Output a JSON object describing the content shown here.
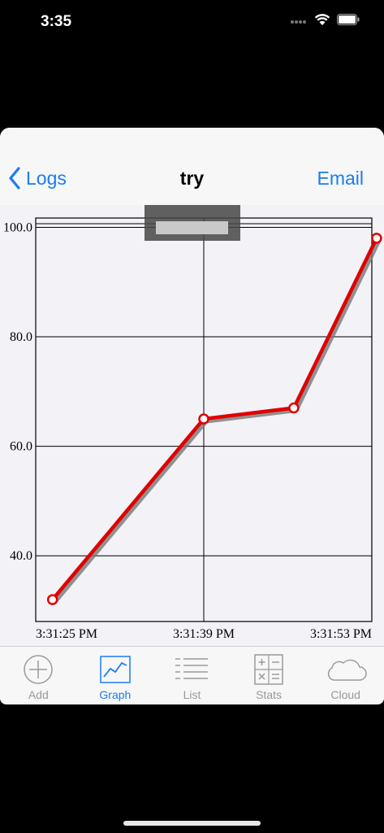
{
  "status": {
    "time": "3:35"
  },
  "navbar": {
    "back_label": "Logs",
    "title": "try",
    "email_label": "Email"
  },
  "tabbar": {
    "tabs": [
      {
        "label": "Add",
        "icon": "plus-circle-icon",
        "active": false
      },
      {
        "label": "Graph",
        "icon": "line-chart-icon",
        "active": true
      },
      {
        "label": "List",
        "icon": "list-icon",
        "active": false
      },
      {
        "label": "Stats",
        "icon": "calculator-icon",
        "active": false
      },
      {
        "label": "Cloud",
        "icon": "cloud-icon",
        "active": false
      }
    ]
  },
  "colors": {
    "accent": "#1a7cf3",
    "line": "#e00000",
    "shadow": "#777777"
  },
  "chart_data": {
    "type": "line",
    "x_tick_labels": [
      "3:31:25 PM",
      "3:31:39 PM",
      "3:31:53 PM"
    ],
    "x_tick_values": [
      0,
      14,
      28
    ],
    "y_tick_labels": [
      "100.0",
      "80.0",
      "60.0",
      "40.0"
    ],
    "y_tick_values": [
      100,
      80,
      60,
      40
    ],
    "xlim": [
      0,
      28
    ],
    "ylim": [
      28,
      101.7
    ],
    "grid": true,
    "series": [
      {
        "x": [
          1.4,
          14,
          21.5,
          28.4
        ],
        "y": [
          32,
          65,
          67,
          98
        ]
      }
    ]
  }
}
